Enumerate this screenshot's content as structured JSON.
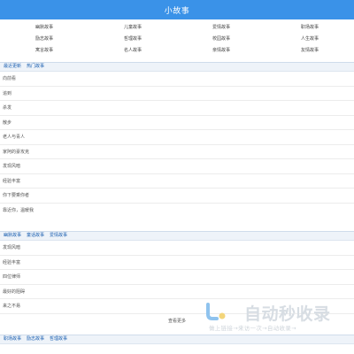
{
  "header": {
    "title": "小故事"
  },
  "categories": [
    "幽默故事",
    "儿童故事",
    "爱情故事",
    "职场故事",
    "励志故事",
    "哲理故事",
    "校园故事",
    "人生故事",
    "寓言故事",
    "名人故事",
    "亲情故事",
    "友情故事"
  ],
  "section1": {
    "tabs": [
      "最近更新",
      "热门故事"
    ],
    "items": [
      "向前看",
      "追到",
      "杀发",
      "散步",
      "老人与青人",
      "家阿的豪攻克",
      "发现风暗",
      "经验丰富",
      "你下要乘你者",
      "靠近你，温暖我"
    ]
  },
  "section2": {
    "tabs": [
      "幽默故事",
      "童话故事",
      "爱情故事"
    ],
    "items": [
      "发现风暗",
      "经验丰富",
      "四位律师",
      "最好的阻碍",
      "来之不易"
    ],
    "more_label": "查看更多"
  },
  "section3": {
    "tabs": [
      "职场故事",
      "励志故事",
      "哲理故事"
    ]
  },
  "watermark": {
    "main": "自动秒收录",
    "sub": "做上链接→来访一次→自动收录→",
    "colors": {
      "logo_blue": "#8fc3ee",
      "logo_yellow": "#f3d57a",
      "text": "#d7dde3"
    }
  },
  "theme": {
    "header_bg": "#3a92e8",
    "tab_text": "#1a5fb0"
  }
}
